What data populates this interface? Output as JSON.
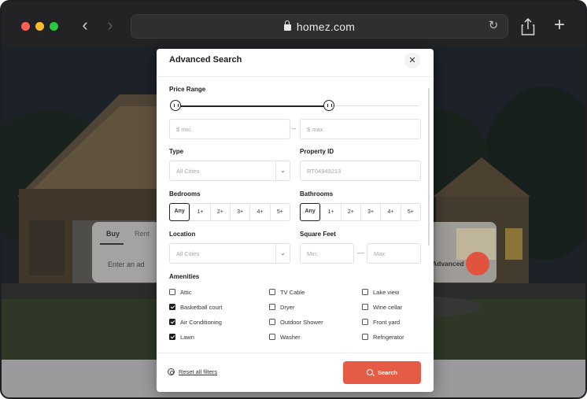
{
  "browser": {
    "url": "homez.com",
    "colors": {
      "close": "#ff5f57",
      "minimize": "#febc2e",
      "maximize": "#28c840"
    }
  },
  "background_search": {
    "tabs": [
      "Buy",
      "Rent"
    ],
    "input_placeholder": "Enter an ad",
    "advanced_label": "Advanced"
  },
  "modal": {
    "title": "Advanced Search",
    "price_range": {
      "label": "Price Range",
      "min_placeholder": "$ min.",
      "max_placeholder": "$ max.",
      "separator": "–"
    },
    "type": {
      "label": "Type",
      "value": "All Cities"
    },
    "property_id": {
      "label": "Property ID",
      "placeholder": "RT04949213"
    },
    "bedrooms": {
      "label": "Bedrooms",
      "options": [
        "Any",
        "1+",
        "2+",
        "3+",
        "4+",
        "5+"
      ],
      "selected": "Any"
    },
    "bathrooms": {
      "label": "Bathrooms",
      "options": [
        "Any",
        "1+",
        "2+",
        "3+",
        "4+",
        "5+"
      ],
      "selected": "Any"
    },
    "location": {
      "label": "Location",
      "value": "All Cities"
    },
    "square_feet": {
      "label": "Square Feet",
      "min_placeholder": "Min.",
      "max_placeholder": "Max",
      "separator": "—"
    },
    "amenities": {
      "label": "Amenities",
      "items": [
        {
          "label": "Attic",
          "checked": false
        },
        {
          "label": "Basketball court",
          "checked": true
        },
        {
          "label": "Air Conditioning",
          "checked": true
        },
        {
          "label": "Lawn",
          "checked": true
        },
        {
          "label": "TV Cable",
          "checked": false
        },
        {
          "label": "Dryer",
          "checked": false
        },
        {
          "label": "Outdoor Shower",
          "checked": false
        },
        {
          "label": "Washer",
          "checked": false
        },
        {
          "label": "Lake view",
          "checked": false
        },
        {
          "label": "Wine cellar",
          "checked": false
        },
        {
          "label": "Front yard",
          "checked": false
        },
        {
          "label": "Refrigerator",
          "checked": false
        }
      ]
    },
    "footer": {
      "reset_label": "Reset all filters",
      "search_label": "Search"
    },
    "accent_color": "#e65b45"
  }
}
